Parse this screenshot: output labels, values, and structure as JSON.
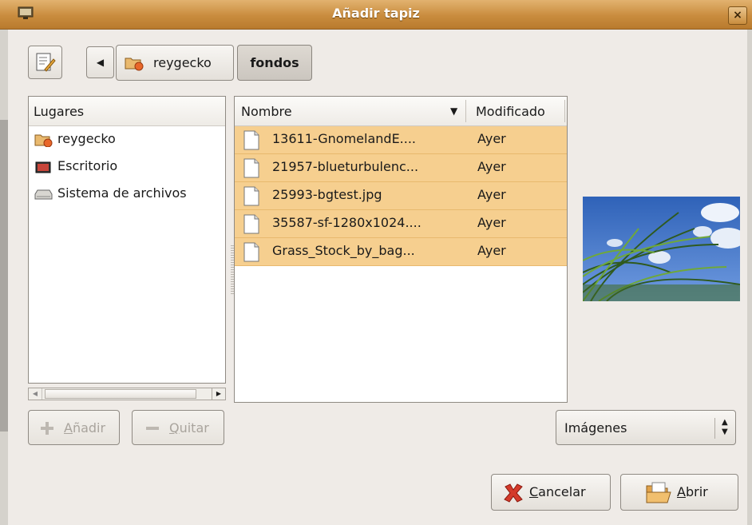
{
  "window": {
    "title": "Añadir tapiz",
    "close_glyph": "×"
  },
  "path_bar": {
    "back_glyph": "◀",
    "crumbs": [
      {
        "label": "reygecko"
      },
      {
        "label": "fondos"
      }
    ]
  },
  "places": {
    "header": "Lugares",
    "items": [
      {
        "label": "reygecko",
        "icon": "home-folder-icon"
      },
      {
        "label": "Escritorio",
        "icon": "desktop-icon"
      },
      {
        "label": "Sistema de archivos",
        "icon": "drive-icon"
      }
    ]
  },
  "file_list": {
    "columns": {
      "name": "Nombre",
      "modified": "Modificado"
    },
    "sort_glyph": "▼",
    "rows": [
      {
        "name": "13611-GnomelandE....",
        "modified": "Ayer"
      },
      {
        "name": "21957-blueturbulenc...",
        "modified": "Ayer"
      },
      {
        "name": "25993-bgtest.jpg",
        "modified": "Ayer"
      },
      {
        "name": "35587-sf-1280x1024....",
        "modified": "Ayer"
      },
      {
        "name": "Grass_Stock_by_bag...",
        "modified": "Ayer"
      }
    ]
  },
  "buttons": {
    "add": {
      "mnemonic": "A",
      "rest": "ñadir"
    },
    "remove": {
      "mnemonic": "Q",
      "rest": "uitar"
    },
    "filter": "Imágenes",
    "cancel": {
      "mnemonic": "C",
      "rest": "ancelar"
    },
    "open": {
      "mnemonic": "A",
      "rest": "brir"
    }
  },
  "colors": {
    "titlebar": "#c98c3e",
    "selection": "#f6cf8f",
    "window_bg": "#efebe7"
  }
}
